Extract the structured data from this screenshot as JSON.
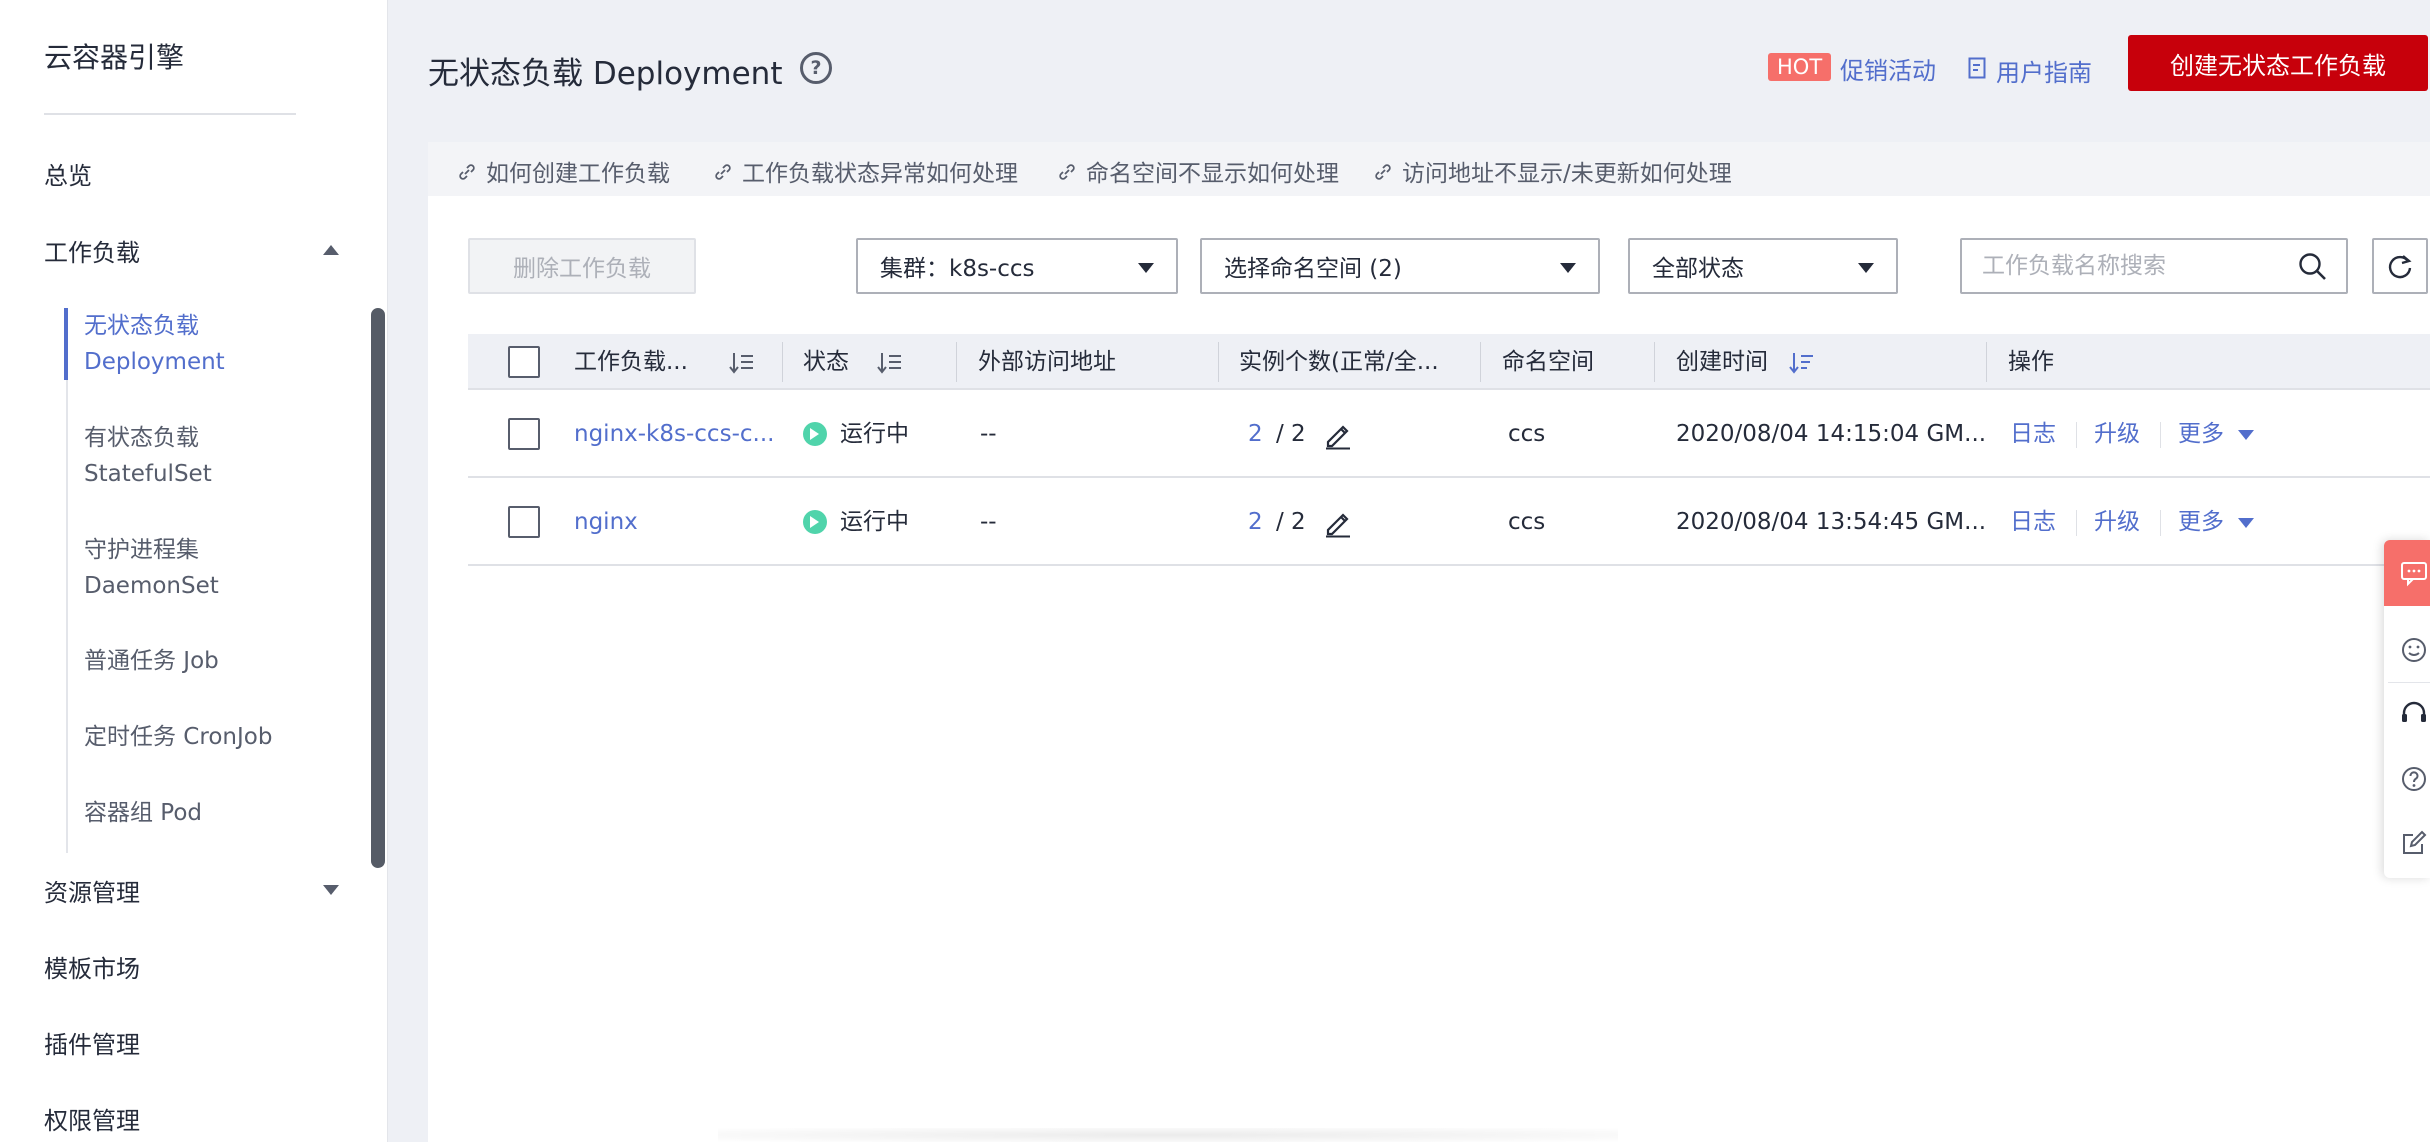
{
  "sidebar": {
    "title": "云容器引擎",
    "items": {
      "overview": "总览",
      "workload": "工作负载",
      "resources": "资源管理",
      "templates": "模板市场",
      "addons": "插件管理",
      "permissions": "权限管理"
    },
    "sub_items": [
      {
        "line1": "无状态负载",
        "line2": "Deployment"
      },
      {
        "line1": "有状态负载",
        "line2": "StatefulSet"
      },
      {
        "line1": "守护进程集",
        "line2": "DaemonSet"
      },
      {
        "line1": "普通任务 Job",
        "line2": ""
      },
      {
        "line1": "定时任务 CronJob",
        "line2": ""
      },
      {
        "line1": "容器组 Pod",
        "line2": ""
      }
    ]
  },
  "header": {
    "title": "无状态负载 Deployment",
    "hot_badge": "HOT",
    "promo_label": "促销活动",
    "guide_label": "用户指南",
    "create_button": "创建无状态工作负载"
  },
  "help_links": [
    "如何创建工作负载",
    "工作负载状态异常如何处理",
    "命名空间不显示如何处理",
    "访问地址不显示/未更新如何处理"
  ],
  "toolbar": {
    "delete_button": "删除工作负载",
    "cluster_select": "集群：k8s-ccs",
    "namespace_select": "选择命名空间 (2)",
    "status_select": "全部状态",
    "search_placeholder": "工作负载名称搜索"
  },
  "table": {
    "columns": [
      "工作负载...",
      "状态",
      "外部访问地址",
      "实例个数(正常/全...",
      "命名空间",
      "创建时间",
      "操作"
    ],
    "rows": [
      {
        "name": "nginx-k8s-ccs-c...",
        "status": "运行中",
        "address": "--",
        "ready": "2",
        "total": "/ 2",
        "namespace": "ccs",
        "created": "2020/08/04 14:15:04 GM...",
        "op_log": "日志",
        "op_upgrade": "升级",
        "op_more": "更多"
      },
      {
        "name": "nginx",
        "status": "运行中",
        "address": "--",
        "ready": "2",
        "total": "/ 2",
        "namespace": "ccs",
        "created": "2020/08/04 13:54:45 GM...",
        "op_log": "日志",
        "op_upgrade": "升级",
        "op_more": "更多"
      }
    ]
  },
  "colors": {
    "brand_red": "#c7000b",
    "link_blue": "#526ecc",
    "running_green": "#50d4ab",
    "hot_red": "#f66f6a"
  },
  "icons": {
    "help": "question-circle-icon",
    "guide": "document-edit-icon",
    "link": "link-icon",
    "search": "search-icon",
    "refresh": "refresh-icon",
    "sort": "sort-icon",
    "edit": "pencil-icon",
    "status": "play-circle-icon",
    "float_panel": [
      "chat-icon",
      "smiley-icon",
      "headset-icon",
      "question-circle-icon",
      "feedback-edit-icon"
    ]
  }
}
